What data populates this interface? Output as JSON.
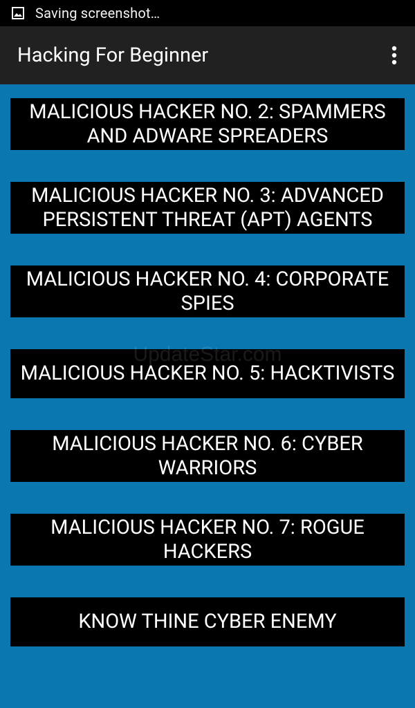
{
  "status_bar": {
    "icon": "image-icon",
    "text": "Saving screenshot…"
  },
  "app_bar": {
    "title": "Hacking For Beginner",
    "menu_icon": "overflow-menu-icon"
  },
  "topics": [
    "MALICIOUS HACKER NO. 2: SPAMMERS AND ADWARE SPREADERS",
    "MALICIOUS HACKER NO. 3: ADVANCED PERSISTENT THREAT (APT) AGENTS",
    "MALICIOUS HACKER NO. 4: CORPORATE SPIES",
    "MALICIOUS HACKER NO. 5: HACKTIVISTS",
    "MALICIOUS HACKER NO. 6: CYBER WARRIORS",
    "MALICIOUS HACKER NO. 7: ROGUE HACKERS",
    "KNOW THINE CYBER ENEMY"
  ],
  "watermark": "UpdateStar.com",
  "colors": {
    "background": "#0a77b0",
    "button": "#000000",
    "app_bar": "#212121",
    "status_bar": "#000000"
  }
}
